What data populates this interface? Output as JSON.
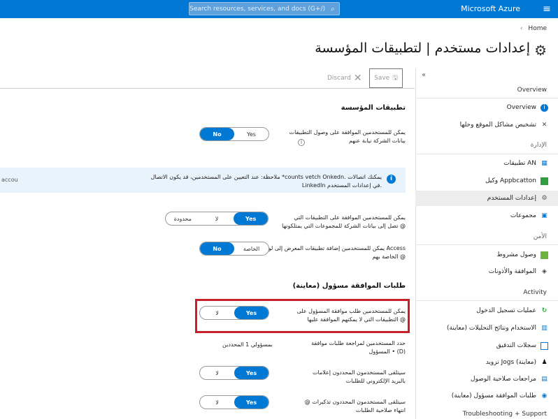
{
  "topbar": {
    "brand": "Microsoft Azure",
    "search_placeholder": "Search resources, services, and docs (G+/)",
    "menu_glyph": "≡",
    "search_glyph": "⌕"
  },
  "breadcrumb": {
    "home": "Home",
    "separator": "‹"
  },
  "page": {
    "title": "إعدادات مستخدم | لتطبيقات المؤسسة",
    "gear_glyph": "⚙"
  },
  "toolbar": {
    "save": "Save",
    "discard": "Discard",
    "save_glyph": "🖫",
    "discard_glyph": "✕"
  },
  "sidebar": {
    "collapse_glyph": "«",
    "header": "Overview",
    "overview_item": "Overview",
    "troubleshoot": "تشخيص مشاكل الموقع وحلها",
    "group_manage": "الإدارة",
    "manage_items": [
      "تطبيقات AN",
      "وكيل Appbcatton",
      "إعدادات المستخدم",
      "مجموعات"
    ],
    "group_security": "الأمن",
    "security_items": [
      "وصول مشروط",
      "الموافقة والأذونات"
    ],
    "group_activity": "Activity",
    "activity_items": [
      "عمليات تسجيل الدخول",
      "الاستخدام ونتائج التحليلات (معاينة)",
      "سجلات التدقيق",
      "تزويد Jogs (معاينة)",
      "مراجعات صلاحية الوصول",
      "طلبات الموافقة مسؤول (معاينة)"
    ],
    "group_support": "Troubleshooting + Support"
  },
  "main": {
    "section_enterprise": "تطبيقات المؤسسة",
    "setting1": [
      "يمكن للمستخدمين الموافقة على وصول التطبيقات",
      "بيانات الشركة نيابة عنهم"
    ],
    "setting1_options": [
      "Yes",
      "No"
    ],
    "banner_text": [
      "ملاحظة: عند التعيين على المستخدمين، قد يكون الاتصال *counts vetch Onkedn. يمكنك اتصالات",
      "LinkedIn في إعدادات المستخدم."
    ],
    "banner_cut": "accou",
    "setting2": [
      "يمكن للمستخدمين الموافقة على التطبيقات التي",
      "تصل إلى بيانات الشركة للمجموعات التي يمتلكونها @"
    ],
    "setting2_options": [
      "Yes",
      "لا",
      "محدودة"
    ],
    "setting3": [
      "يمكن للمستخدمين إضافة تطبيقات المعرض إلى لوحة Access",
      "الخاصة بهم @"
    ],
    "setting3_options": [
      "الخاصة",
      "No"
    ],
    "section_admin": "طلبات الموافقة مسؤول (معاينة)",
    "setting4": [
      "يمكن للمستخدمين طلب موافقة المسؤول على",
      "التطبيقات التي لا يمكنهم الموافقة عليها @"
    ],
    "setting4_options": [
      "Yes",
      "لا"
    ],
    "setting5": [
      "حدد المستخدمين لمراجعة طلبات موافقة",
      "المسؤول • (D)"
    ],
    "setting5_value": "بمسؤولي 1 المحددين",
    "setting6": [
      "سيتلقى المستخدمون المحددون إعلامات",
      "بالبريد الإلكتروني للطلبات"
    ],
    "setting6_options": [
      "Yes",
      "لا"
    ],
    "setting7": [
      "@ سيتلقى المستخدمون المحددون تذكيرات",
      "انتهاء صلاحية الطلبات"
    ],
    "setting7_options": [
      "Yes",
      "لا"
    ],
    "info_glyph": "i"
  },
  "colors": {
    "accent": "#0078d4",
    "highlight": "#c8202b"
  }
}
